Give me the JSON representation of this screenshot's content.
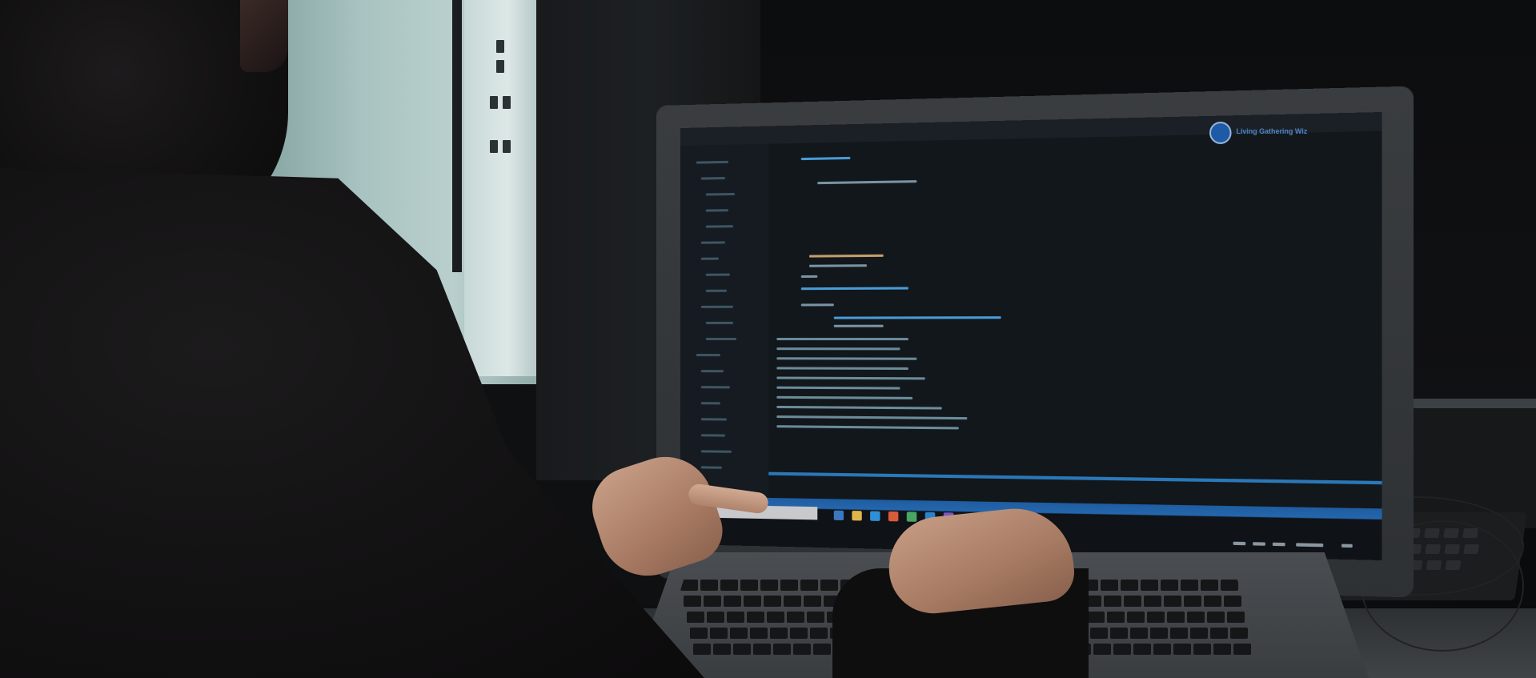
{
  "scene": {
    "description_tag": "photo",
    "sticker_text": "Living Gathering Wiz"
  },
  "colors": {
    "taskbar_accent": "#2466ad",
    "code_keyword": "#4a9bd6",
    "code_string": "#c59d6a",
    "code_plain": "#7a93a3",
    "sticker_blue": "#1e5aa6"
  },
  "icons": [
    "sticker-logo-icon",
    "windows-start-icon",
    "taskbar-app-icon"
  ]
}
